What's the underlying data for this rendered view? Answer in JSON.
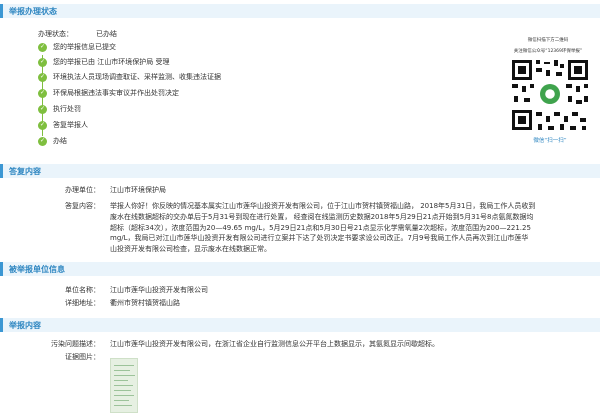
{
  "sections": {
    "status": "举报办理状态",
    "reply": "答复内容",
    "reported_unit": "被举报单位信息",
    "report": "举报内容"
  },
  "status": {
    "key": "办理状态：",
    "value": "已办结"
  },
  "steps": [
    "您的举报信息已提交",
    "您的举报已由 江山市环境保护局 受理",
    "环境执法人员现场调查取证、采样监测、收集违法证据",
    "环保局根据违法事实审议并作出处罚决定",
    "执行处罚",
    "答复举报人",
    "办结"
  ],
  "qr": {
    "note1": "微信扫描下方二维码",
    "note2": "关注微信公众号“12369环保举报”",
    "caption": "微信“扫一扫”"
  },
  "reply": {
    "unit_label": "办理单位：",
    "unit_value": "江山市环境保护局",
    "content_label": "答复内容：",
    "content_lines": [
      "举报人你好！你反映的情况基本属实江山市莲华山投资开发有限公司，位于江山市贺村镇贺福山路， 2018年5月31日，我局工作人员收到",
      "废水在线数据超标的交办单后于5月31号到现在进行处置， 经查阅在线监测历史数据2018年5月29日21点开始到5月31号8点氨氮数据均",
      "超标（超标34次），浓度范围为20—49.65 mg/L，5月29日21点和5月30日号21点显示化学需氧量2次超标，浓度范围为200—221.25",
      "mg/L，我局已对江山市莲华山投资开发有限公司进行立案并下达了处罚决定书要求设公司改正。7月9号我局工作人员再次到江山市莲华",
      "山投资开发有限公司检查，显示废水在线数据正常。"
    ]
  },
  "reported_unit": {
    "name_label": "单位名称：",
    "name_value": "江山市莲华山投资开发有限公司",
    "addr_label": "详细地址：",
    "addr_value": "衢州市贺村镇贺福山路"
  },
  "report": {
    "desc_label": "污染问题描述：",
    "desc_value": "江山市莲华山投资开发有限公司，在浙江省企业自行监测信息公开平台上数据显示，其氨氮显示间歇超标。",
    "photo_label": "证据图片："
  },
  "colors": {
    "accent": "#2e86c1",
    "step_done": "#7fbf3f",
    "section_bg": "#eaf4fb"
  }
}
